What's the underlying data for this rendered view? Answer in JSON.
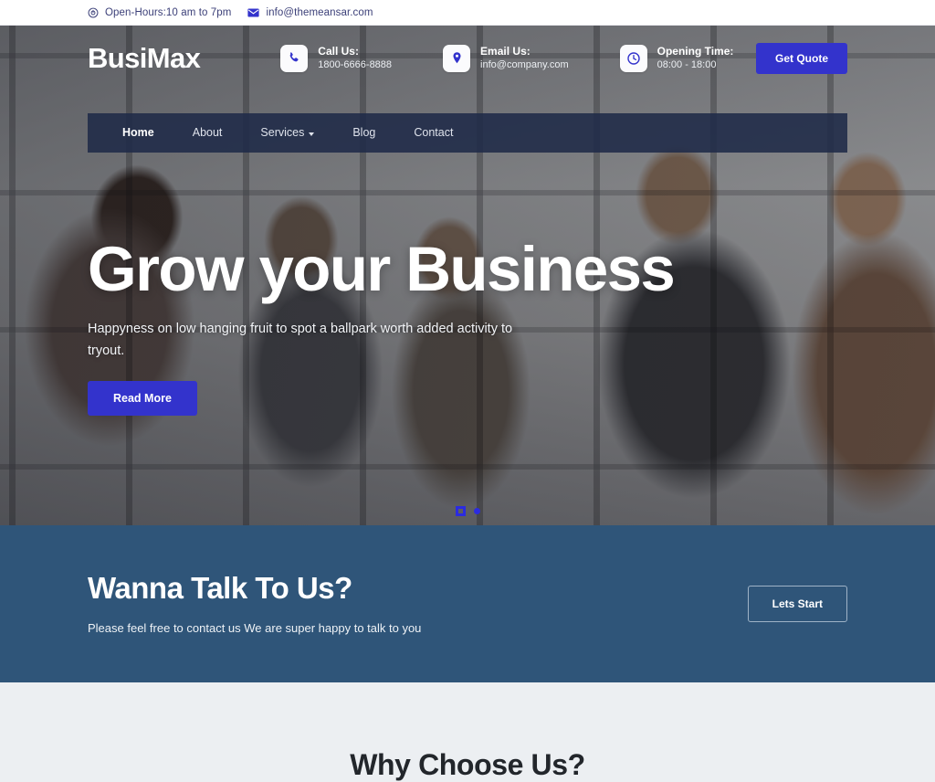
{
  "topbar": {
    "items": [
      {
        "icon": "clock-icon",
        "text": "Open-Hours:10 am to 7pm"
      },
      {
        "icon": "envelope-icon",
        "text": "info@themeansar.com"
      }
    ]
  },
  "header": {
    "logo": "BusiMax",
    "contacts": [
      {
        "icon": "phone-icon",
        "title": "Call Us:",
        "value": "1800-6666-8888"
      },
      {
        "icon": "map-pin-icon",
        "title": "Email Us:",
        "value": "info@company.com"
      },
      {
        "icon": "clock-icon",
        "title": "Opening Time:",
        "value": "08:00 - 18:00"
      }
    ],
    "quote_button": "Get Quote"
  },
  "nav": {
    "items": [
      {
        "label": "Home",
        "active": true,
        "has_dropdown": false
      },
      {
        "label": "About",
        "active": false,
        "has_dropdown": false
      },
      {
        "label": "Services",
        "active": false,
        "has_dropdown": true
      },
      {
        "label": "Blog",
        "active": false,
        "has_dropdown": false
      },
      {
        "label": "Contact",
        "active": false,
        "has_dropdown": false
      }
    ]
  },
  "hero": {
    "title": "Grow your Business",
    "subtitle": "Happyness on low hanging fruit to spot a ballpark worth added activity to tryout.",
    "button": "Read More",
    "slides": [
      {
        "type": "square",
        "active": true
      },
      {
        "type": "round",
        "active": false
      }
    ]
  },
  "cta": {
    "title": "Wanna Talk To Us?",
    "subtitle": "Please feel free to contact us We are super happy to talk to you",
    "button": "Lets Start"
  },
  "why": {
    "title": "Why Choose Us?"
  },
  "colors": {
    "accent_blue": "#3333cc",
    "nav_navy": "#1f2a48",
    "cta_steel": "#2f5579",
    "section_gray": "#eceff2",
    "topbar_text": "#3b3f78"
  }
}
